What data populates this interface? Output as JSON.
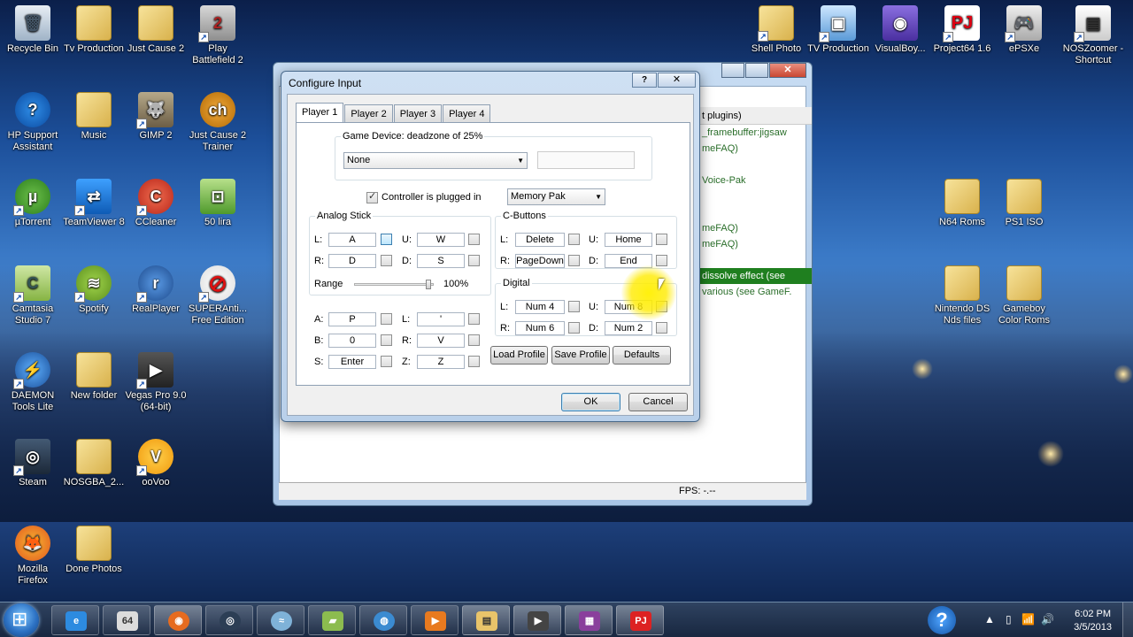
{
  "desktop": {
    "left_icons": [
      {
        "label": "Recycle Bin",
        "glyph": "🗑"
      },
      {
        "label": "HP Support Assistant",
        "glyph": "?"
      },
      {
        "label": "µTorrent",
        "glyph": "µ"
      },
      {
        "label": "Camtasia Studio 7",
        "glyph": "C"
      },
      {
        "label": "DAEMON Tools Lite",
        "glyph": "⚡"
      },
      {
        "label": "Steam",
        "glyph": "◎"
      },
      {
        "label": "Mozilla Firefox",
        "glyph": "🦊"
      },
      {
        "label": "Tv Production",
        "glyph": ""
      },
      {
        "label": "Music",
        "glyph": ""
      },
      {
        "label": "TeamViewer 8",
        "glyph": "⇄"
      },
      {
        "label": "Spotify",
        "glyph": "≋"
      },
      {
        "label": "New folder",
        "glyph": ""
      },
      {
        "label": "NOSGBA_2...",
        "glyph": ""
      },
      {
        "label": "Done Photos",
        "glyph": ""
      },
      {
        "label": "Just Cause 2",
        "glyph": ""
      },
      {
        "label": "GIMP 2",
        "glyph": "🐺"
      },
      {
        "label": "CCleaner",
        "glyph": "C"
      },
      {
        "label": "RealPlayer",
        "glyph": "r"
      },
      {
        "label": "Vegas Pro 9.0 (64-bit)",
        "glyph": "▶"
      },
      {
        "label": "ooVoo",
        "glyph": "V"
      },
      {
        "label": "Play Battlefield 2",
        "glyph": "2"
      },
      {
        "label": "Just Cause 2 Trainer",
        "glyph": "ch"
      },
      {
        "label": "50 lira",
        "glyph": "⊡"
      },
      {
        "label": "SUPERAnti... Free Edition",
        "glyph": "⊘"
      }
    ],
    "right_icons": [
      {
        "label": "Shell Photo",
        "glyph": ""
      },
      {
        "label": "TV Production",
        "glyph": "▣"
      },
      {
        "label": "VisualBoy...",
        "glyph": "◉"
      },
      {
        "label": "Project64 1.6",
        "glyph": "PJ"
      },
      {
        "label": "ePSXe",
        "glyph": "🎮"
      },
      {
        "label": "NOSZoomer - Shortcut",
        "glyph": "▤"
      },
      {
        "label": "N64 Roms",
        "glyph": ""
      },
      {
        "label": "PS1 ISO",
        "glyph": ""
      },
      {
        "label": "Nintendo DS Nds files",
        "glyph": ""
      },
      {
        "label": "Gameboy Color Roms",
        "glyph": ""
      }
    ]
  },
  "background_window": {
    "list_header": "t plugins)",
    "items": [
      "_framebuffer:jigsaw",
      "meFAQ)",
      "",
      "Voice-Pak",
      "",
      "",
      "meFAQ)",
      "meFAQ)",
      "",
      "dissolve effect (see",
      "various (see GameF."
    ],
    "selected_item": "dissolve effect (see",
    "fps": "FPS: -.--"
  },
  "dialog": {
    "title": "Configure Input",
    "help_btn": "?",
    "close_btn": "✕",
    "tabs": [
      "Player 1",
      "Player 2",
      "Player 3",
      "Player 4"
    ],
    "game_device_label": "Game Device: deadzone of 25%",
    "game_device_value": "None",
    "controller_plugged_label": "Controller is plugged in",
    "controller_plugged": true,
    "pak_value": "Memory Pak",
    "analog_stick": {
      "label": "Analog Stick",
      "L": "A",
      "U": "W",
      "R": "D",
      "D": "S",
      "range_label": "Range",
      "range_value": "100%"
    },
    "c_buttons": {
      "label": "C-Buttons",
      "L": "Delete",
      "U": "Home",
      "R": "PageDown",
      "D": "End"
    },
    "digital": {
      "label": "Digital",
      "L": "Num 4",
      "U": "Num 8",
      "R": "Num 6",
      "D": "Num 2"
    },
    "buttons": {
      "A": "P",
      "L": "'",
      "B": "0",
      "R": "V",
      "S": "Enter",
      "Z": "Z"
    },
    "letters": {
      "L": "L:",
      "U": "U:",
      "R": "R:",
      "D": "D:",
      "A": "A:",
      "B": "B:",
      "S": "S:",
      "Z": "Z:"
    },
    "load_profile": "Load Profile",
    "save_profile": "Save Profile",
    "defaults": "Defaults",
    "ok": "OK",
    "cancel": "Cancel"
  },
  "taskbar": {
    "apps": [
      {
        "name": "ie",
        "glyph": "e",
        "color": "#2d8be0"
      },
      {
        "name": "project64-file",
        "glyph": "64",
        "color": "#dcdcdc"
      },
      {
        "name": "firefox",
        "glyph": "◉",
        "color": "#e66b1f"
      },
      {
        "name": "steam",
        "glyph": "◎",
        "color": "#2c3e55"
      },
      {
        "name": "hdd",
        "glyph": "≈",
        "color": "#7fb2d8"
      },
      {
        "name": "camtasia",
        "glyph": "▰",
        "color": "#8cbc4f"
      },
      {
        "name": "network",
        "glyph": "◍",
        "color": "#3b8bd1"
      },
      {
        "name": "media",
        "glyph": "▶",
        "color": "#e87a1f"
      },
      {
        "name": "explorer",
        "glyph": "▤",
        "color": "#e9c46a"
      },
      {
        "name": "vegas",
        "glyph": "▶",
        "color": "#444"
      },
      {
        "name": "winrar",
        "glyph": "▦",
        "color": "#8a3f9c"
      },
      {
        "name": "project64",
        "glyph": "PJ",
        "color": "#d22"
      }
    ],
    "time": "6:02 PM",
    "date": "3/5/2013"
  }
}
